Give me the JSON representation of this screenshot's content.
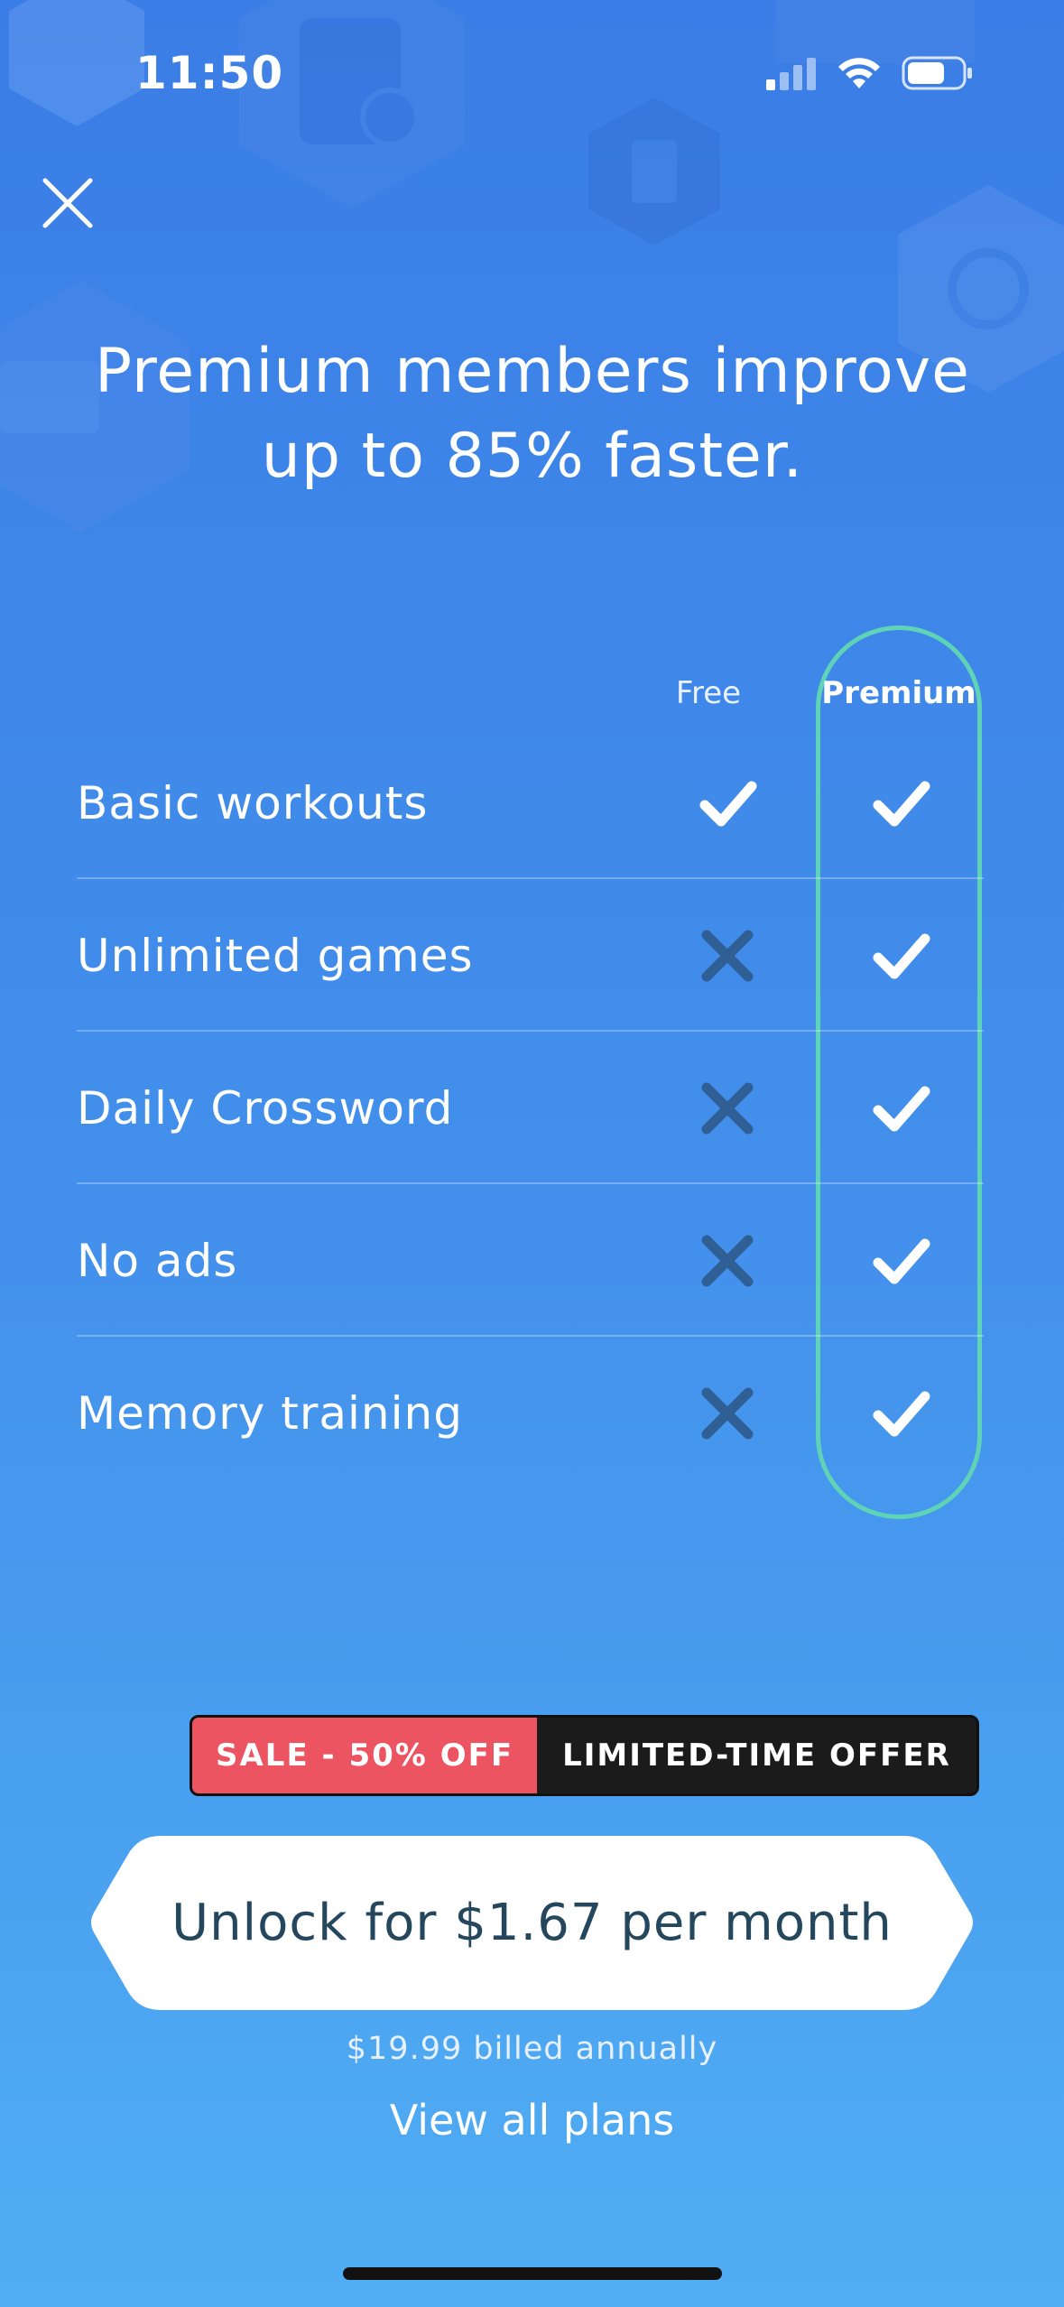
{
  "status_bar": {
    "time": "11:50",
    "icons": [
      "cellular-signal-icon",
      "wifi-icon",
      "battery-icon"
    ]
  },
  "header": {
    "close_icon": "close-icon",
    "headline": "Premium members improve up to 85% faster."
  },
  "comparison": {
    "columns": {
      "free": "Free",
      "premium": "Premium"
    },
    "rows": [
      {
        "label": "Basic workouts",
        "free": true,
        "premium": true
      },
      {
        "label": "Unlimited games",
        "free": false,
        "premium": true
      },
      {
        "label": "Daily Crossword",
        "free": false,
        "premium": true
      },
      {
        "label": "No ads",
        "free": false,
        "premium": true
      },
      {
        "label": "Memory training",
        "free": false,
        "premium": true
      }
    ]
  },
  "offer": {
    "sale_label": "SALE - 50% OFF",
    "limited_label": "LIMITED-TIME OFFER"
  },
  "cta": {
    "label": "Unlock for $1.67 per month",
    "billing_note": "$19.99 billed annually",
    "secondary_link": "View all plans"
  },
  "colors": {
    "background_top": "#3a7de6",
    "background_bottom": "#50aef3",
    "premium_outline": "#5fd3b6",
    "sale_red": "#ec5461",
    "badge_dark": "#1b1b1b",
    "cross_mark": "#2f5f94",
    "cta_text": "#24475e"
  }
}
